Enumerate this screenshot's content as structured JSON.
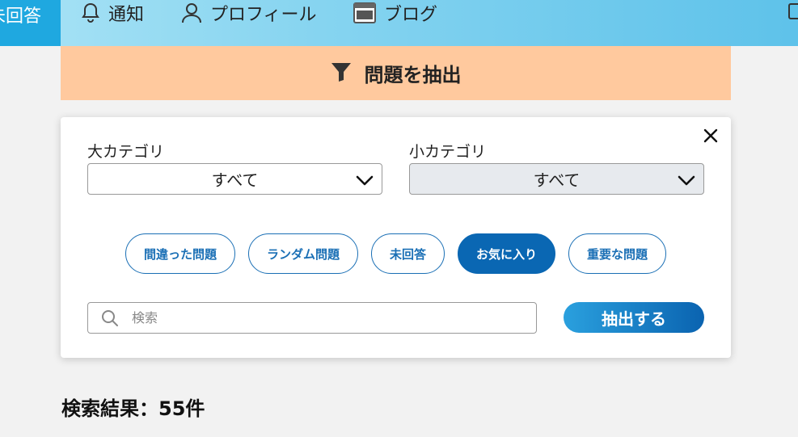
{
  "nav": {
    "active_label": "未回答",
    "items": [
      {
        "label": "通知",
        "icon": "bell-icon"
      },
      {
        "label": "プロフィール",
        "icon": "user-icon"
      },
      {
        "label": "ブログ",
        "icon": "blog-icon"
      }
    ]
  },
  "banner": {
    "title": "問題を抽出",
    "icon": "filter-icon"
  },
  "filter": {
    "major_category": {
      "label": "大カテゴリ",
      "value": "すべて"
    },
    "minor_category": {
      "label": "小カテゴリ",
      "value": "すべて"
    },
    "chips": [
      {
        "label": "間違った問題",
        "active": false
      },
      {
        "label": "ランダム問題",
        "active": false
      },
      {
        "label": "未回答",
        "active": false
      },
      {
        "label": "お気に入り",
        "active": true
      },
      {
        "label": "重要な問題",
        "active": false
      }
    ],
    "search": {
      "placeholder": "検索",
      "value": ""
    },
    "submit_label": "抽出する"
  },
  "results": {
    "label": "検索結果：",
    "count": "55件"
  },
  "colors": {
    "accent": "#0a67b3",
    "banner_bg": "#ffc99e",
    "nav_active_bg": "#1fa8e0",
    "nav_bg_end": "#5ec2ea"
  }
}
